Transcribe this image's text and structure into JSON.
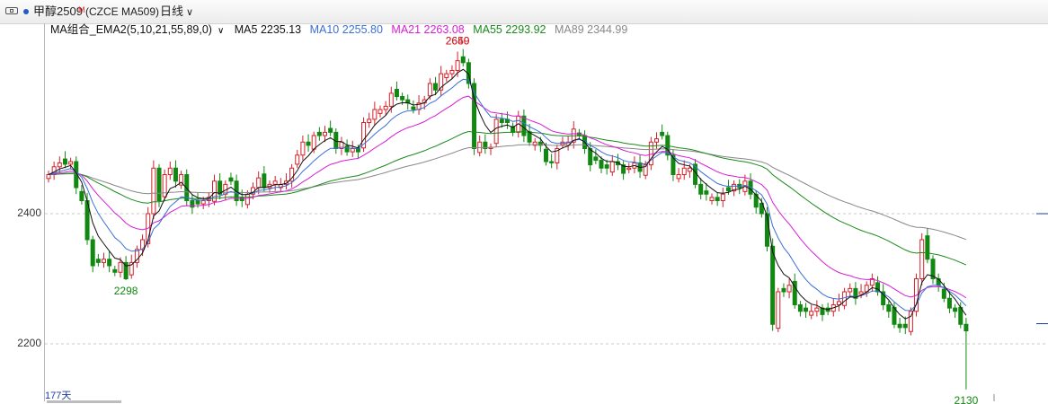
{
  "header": {
    "symbol_name": "甲醇2509",
    "symbol_sup": "M",
    "symbol_code": "(CZCE MA509)",
    "period": "日线",
    "period_caret": "∨",
    "window_icon": "window-icon"
  },
  "legend": {
    "group_label": "MA组合_EMA2(5,10,21,55,89,0)",
    "dropdown_caret": "∨",
    "items": [
      {
        "label": "MA5 2235.13",
        "color": "#111111"
      },
      {
        "label": "MA10 2255.80",
        "color": "#3a6fd8"
      },
      {
        "label": "MA21 2263.08",
        "color": "#d61ed6"
      },
      {
        "label": "MA55 2293.92",
        "color": "#1a8a1a"
      },
      {
        "label": "MA89 2344.99",
        "color": "#888888"
      }
    ]
  },
  "count_label": "177天",
  "colors": {
    "up": "#d5202a",
    "down": "#118811",
    "grid": "#c8c8c8"
  },
  "chart_data": {
    "type": "candlestick",
    "y_ticks": [
      2200,
      2400
    ],
    "annotations": [
      {
        "text": "2650",
        "value": 2650,
        "color": "#d5202a"
      },
      {
        "text": "2649",
        "value": 2649,
        "color": "#d5202a"
      },
      {
        "text": "2298",
        "value": 2298,
        "color": "#118811"
      },
      {
        "text": "2130",
        "value": 2130,
        "color": "#118811"
      }
    ],
    "closes": [
      2460,
      2472,
      2478,
      2476,
      2480,
      2440,
      2420,
      2360,
      2320,
      2325,
      2330,
      2320,
      2310,
      2325,
      2300,
      2325,
      2345,
      2360,
      2400,
      2470,
      2420,
      2460,
      2470,
      2450,
      2460,
      2420,
      2410,
      2415,
      2420,
      2425,
      2450,
      2430,
      2445,
      2450,
      2420,
      2420,
      2430,
      2440,
      2455,
      2440,
      2445,
      2450,
      2445,
      2450,
      2470,
      2490,
      2510,
      2505,
      2520,
      2520,
      2525,
      2525,
      2500,
      2510,
      2495,
      2500,
      2495,
      2540,
      2545,
      2560,
      2560,
      2565,
      2585,
      2580,
      2575,
      2570,
      2560,
      2570,
      2575,
      2600,
      2590,
      2615,
      2615,
      2620,
      2635,
      2632,
      2600,
      2500,
      2510,
      2500,
      2502,
      2545,
      2540,
      2540,
      2525,
      2550,
      2520,
      2510,
      2510,
      2505,
      2480,
      2478,
      2500,
      2510,
      2510,
      2530,
      2520,
      2500,
      2475,
      2482,
      2470,
      2470,
      2480,
      2475,
      2462,
      2470,
      2478,
      2465,
      2475,
      2510,
      2515,
      2520,
      2490,
      2460,
      2460,
      2470,
      2470,
      2445,
      2430,
      2430,
      2425,
      2420,
      2430,
      2435,
      2445,
      2440,
      2450,
      2430,
      2410,
      2400,
      2350,
      2230,
      2280,
      2280,
      2290,
      2260,
      2250,
      2250,
      2250,
      2255,
      2245,
      2250,
      2260,
      2265,
      2280,
      2285,
      2270,
      2280,
      2290,
      2300,
      2280,
      2260,
      2250,
      2230,
      2225,
      2225,
      2250,
      2300,
      2360,
      2330,
      2300,
      2290,
      2270,
      2255,
      2250,
      2230,
      2220
    ]
  }
}
